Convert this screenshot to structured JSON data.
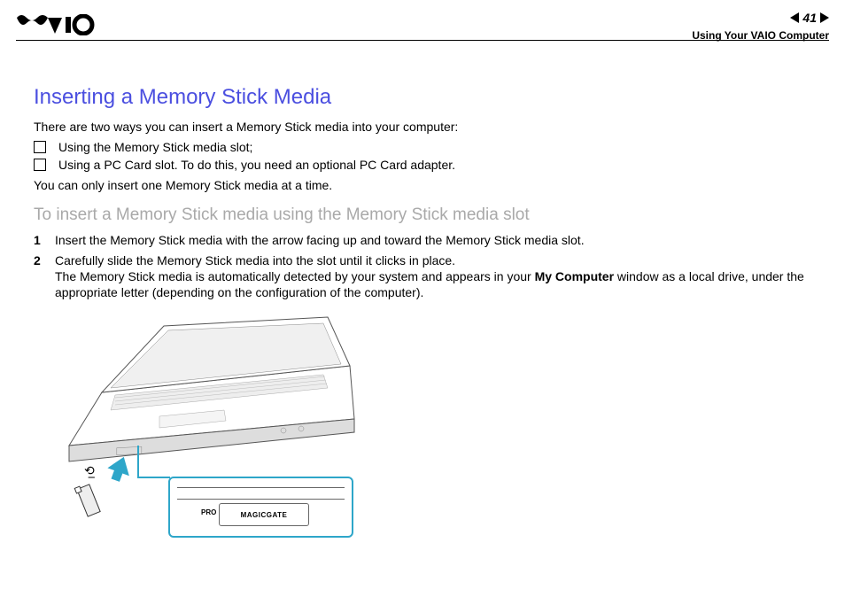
{
  "header": {
    "page_number": "41",
    "section": "Using Your VAIO Computer"
  },
  "content": {
    "title": "Inserting a Memory Stick Media",
    "intro": "There are two ways you can insert a Memory Stick media into your computer:",
    "bullets": [
      "Using the Memory Stick media slot;",
      "Using a PC Card slot. To do this, you need an optional PC Card adapter."
    ],
    "note": "You can only insert one Memory Stick media at a time.",
    "sub_title": "To insert a Memory Stick media using the Memory Stick media slot",
    "steps": [
      {
        "n": "1",
        "text_html": "Insert the Memory Stick media with the arrow facing up and toward the Memory Stick media slot."
      },
      {
        "n": "2",
        "text_html": "Carefully slide the Memory Stick media into the slot until it clicks in place.\nThe Memory Stick media is automatically detected by your system and appears in your <b>My Computer</b> window as a local drive, under the appropriate letter (depending on the configuration of the computer)."
      }
    ],
    "illustration": {
      "pro_label": "PRO",
      "magicgate_label": "MAGICGATE"
    }
  }
}
